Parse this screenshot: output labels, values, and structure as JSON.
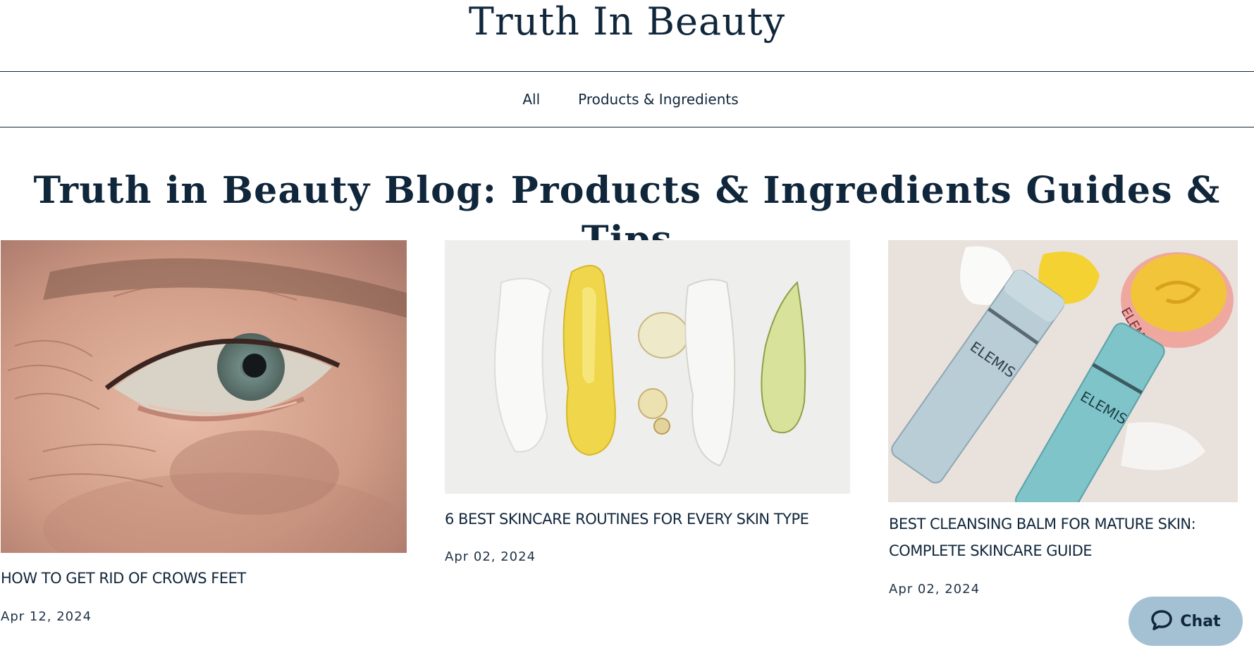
{
  "header": {
    "site_title": "Truth In Beauty"
  },
  "nav": {
    "items": [
      {
        "label": "All"
      },
      {
        "label": "Products & Ingredients"
      }
    ]
  },
  "page": {
    "heading": "Truth in Beauty Blog: Products & Ingredients Guides & Tips"
  },
  "posts": [
    {
      "title": "HOW TO GET RID OF CROWS FEET",
      "date": "Apr 12, 2024",
      "image": "eye-closeup-image"
    },
    {
      "title": "6 BEST SKINCARE ROUTINES FOR EVERY SKIN TYPE",
      "date": "Apr 02, 2024",
      "image": "product-swatches-image"
    },
    {
      "title": "BEST CLEANSING BALM FOR MATURE SKIN: COMPLETE SKINCARE GUIDE",
      "date": "Apr 02, 2024",
      "image": "elemis-products-image"
    }
  ],
  "product_labels": {
    "brand": "ELEMIS"
  },
  "chat": {
    "label": "Chat",
    "icon": "chat-bubble-icon"
  },
  "colors": {
    "text": "#10263b",
    "chat_bg": "#a4c0d3"
  }
}
